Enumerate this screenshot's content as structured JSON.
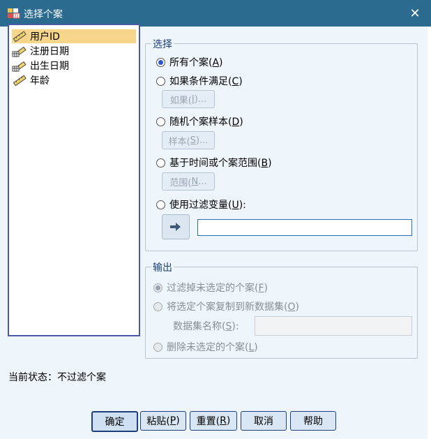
{
  "window": {
    "title": "选择个案",
    "close_glyph": "✕"
  },
  "variables": [
    {
      "label": "用户ID",
      "icon": "ruler-scale-icon",
      "selected": true
    },
    {
      "label": "注册日期",
      "icon": "calendar-scale-icon",
      "selected": false
    },
    {
      "label": "出生日期",
      "icon": "calendar-scale-icon",
      "selected": false
    },
    {
      "label": "年龄",
      "icon": "ruler-scale-icon",
      "selected": false
    }
  ],
  "select_group": {
    "legend": "选择",
    "all_cases": {
      "text": "所有个案(",
      "key": "A",
      "end": ")",
      "checked": true
    },
    "if_condition": {
      "text": "如果条件满足(",
      "key": "C",
      "end": ")",
      "checked": false
    },
    "if_button": {
      "text": "如果(",
      "key": "I",
      "end": ")..."
    },
    "random_sample": {
      "text": "随机个案样本(",
      "key": "D",
      "end": ")",
      "checked": false
    },
    "sample_button": {
      "text": "样本(",
      "key": "S",
      "end": ")..."
    },
    "range_option": {
      "text": "基于时间或个案范围(",
      "key": "B",
      "end": ")",
      "checked": false
    },
    "range_button": {
      "text": "范围(",
      "key": "N",
      "end": "..."
    },
    "filter_variable": {
      "text": "使用过滤变量(",
      "key": "U",
      "end": "):",
      "checked": false
    },
    "filter_value": ""
  },
  "output_group": {
    "legend": "输出",
    "filter_out": {
      "text": "过滤掉未选定的个案(",
      "key": "F",
      "end": ")",
      "checked": true
    },
    "copy_to_dataset": {
      "text": "将选定个案复制到新数据集(",
      "key": "O",
      "end": ")",
      "checked": false
    },
    "dataset_name_label": {
      "text": "数据集名称(",
      "key": "S",
      "end": "):"
    },
    "dataset_name_value": "",
    "delete_unselected": {
      "text": "删除未选定的个案(",
      "key": "L",
      "end": ")",
      "checked": false
    }
  },
  "status": "当前状态：不过滤个案",
  "buttons": {
    "ok": "确定",
    "paste": {
      "text": "粘贴(",
      "key": "P",
      "end": ")"
    },
    "reset": {
      "text": "重置(",
      "key": "R",
      "end": ")"
    },
    "cancel": "取消",
    "help": "帮助"
  },
  "colors": {
    "titlebar": "#2a6b8f",
    "client": "#eef5fb",
    "selection": "#f7d58b",
    "accent": "#2b55c8"
  }
}
